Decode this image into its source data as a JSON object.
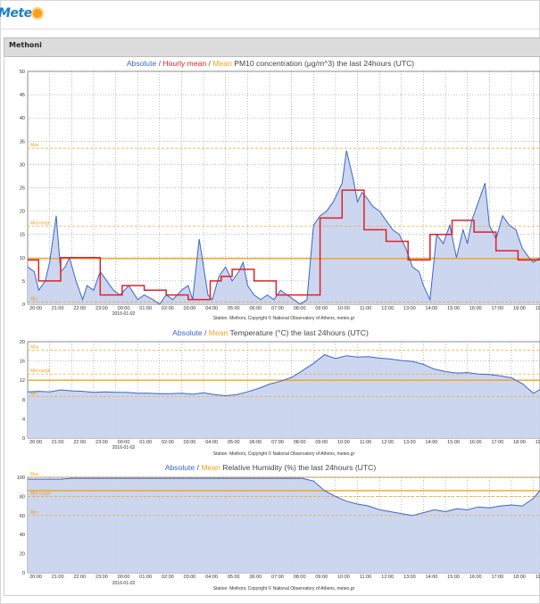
{
  "site": {
    "logo_text": "Mete",
    "logo_icon": "sun-icon"
  },
  "station_header": "Methoni",
  "chart_data": [
    {
      "type": "line",
      "title_parts": [
        {
          "text": "Absolute",
          "color": "#3a67c9"
        },
        {
          "text": " / ",
          "color": "#555555"
        },
        {
          "text": "Hourly mean",
          "color": "#e0202a"
        },
        {
          "text": " / ",
          "color": "#555555"
        },
        {
          "text": "Mean",
          "color": "#f2a21e"
        },
        {
          "text": " PM10 concentration (μg/m^3) the last 24hours (UTC)",
          "color": "#444444"
        }
      ],
      "ylim": [
        0,
        50
      ],
      "yticks": [
        0,
        5,
        10,
        15,
        20,
        25,
        30,
        35,
        40,
        45,
        50
      ],
      "x_ticks": [
        "20:00",
        "21:00",
        "22:00",
        "23:00",
        "00:00",
        "01:00",
        "02:00",
        "03:00",
        "04:00",
        "05:00",
        "06:00",
        "07:00",
        "08:00",
        "09:00",
        "10:00",
        "11:00",
        "12:00",
        "13:00",
        "14:00",
        "15:00",
        "16:00",
        "17:00",
        "18:00",
        "19:00"
      ],
      "date_label": "2016-01-02",
      "xrange": [
        0,
        23.3
      ],
      "footer": "Station: Methoni, Copyright © National Observatory of Athens, meteo.gr",
      "ref_lines": [
        {
          "label": "Max",
          "value": 33.5,
          "style": "dashed"
        },
        {
          "label": "Mid-range",
          "value": 16.8,
          "style": "dashed"
        },
        {
          "label": "Min",
          "value": 0.5,
          "style": "dashed"
        },
        {
          "label": "",
          "value": 9.8,
          "style": "solid"
        }
      ],
      "colors": {
        "absolute": "#3a67c9",
        "fill": "#c9d4ee",
        "hourly": "#e0202a",
        "mean": "#f2a21e"
      },
      "series": [
        {
          "name": "Absolute",
          "x": [
            0,
            0.3,
            0.5,
            0.8,
            1,
            1.3,
            1.5,
            1.7,
            1.9,
            2.2,
            2.5,
            2.7,
            3,
            3.3,
            3.6,
            3.9,
            4.2,
            4.6,
            5,
            5.3,
            5.7,
            6,
            6.3,
            6.6,
            7,
            7.3,
            7.5,
            7.8,
            8,
            8.2,
            8.4,
            8.7,
            9,
            9.3,
            9.6,
            9.8,
            10,
            10.3,
            10.6,
            10.9,
            11.2,
            11.5,
            11.8,
            12.1,
            12.4,
            12.7,
            13,
            13.3,
            13.6,
            13.9,
            14.1,
            14.3,
            14.5,
            14.8,
            15,
            15.2,
            15.4,
            15.7,
            16,
            16.3,
            16.6,
            16.9,
            17.2,
            17.5,
            17.8,
            18,
            18.3,
            18.6,
            18.9,
            19.2,
            19.5,
            19.8,
            20,
            20.2,
            20.5,
            20.8,
            21,
            21.3,
            21.6,
            21.9,
            22.2,
            22.5,
            22.8,
            23,
            23.3
          ],
          "values": [
            8,
            7,
            3,
            5,
            9,
            19,
            7,
            8,
            10,
            5,
            1,
            4,
            3,
            7,
            5,
            3,
            2,
            4,
            1,
            2,
            1,
            0,
            2,
            1,
            3,
            4,
            1,
            14,
            8,
            2,
            1,
            6,
            8,
            5,
            7,
            9,
            4,
            2,
            1,
            2,
            1,
            3,
            2,
            1,
            0,
            1,
            17,
            19,
            20,
            22,
            24,
            26,
            33,
            27,
            22,
            24,
            23,
            21,
            20,
            18,
            16,
            15,
            12,
            8,
            7,
            4,
            1,
            15,
            13,
            17,
            10,
            16,
            13,
            18,
            22,
            26,
            17,
            14,
            19,
            17,
            16,
            12,
            10,
            9,
            10
          ]
        },
        {
          "name": "Hourly mean",
          "x": [
            0,
            0.5,
            1,
            1.5,
            2.3,
            3.3,
            4.3,
            5.3,
            6.3,
            7.3,
            8.3,
            8.8,
            9.3,
            10.3,
            11.3,
            12.3,
            13.3,
            14.3,
            15.3,
            16.3,
            17.3,
            18.3,
            19.3,
            20.3,
            21.3,
            22.3,
            23.3
          ],
          "values": [
            9.5,
            5,
            5,
            10,
            10,
            2,
            4,
            3,
            2,
            1,
            5,
            6,
            7.5,
            5,
            2,
            2,
            18.5,
            24.5,
            16,
            13.5,
            9.5,
            15,
            18,
            15.5,
            11.5,
            9.5,
            9.5
          ]
        },
        {
          "name": "Mean",
          "values": [
            9.8
          ]
        }
      ]
    },
    {
      "type": "line",
      "title_parts": [
        {
          "text": "Absolute",
          "color": "#3a67c9"
        },
        {
          "text": " / ",
          "color": "#555555"
        },
        {
          "text": "Mean",
          "color": "#f2a21e"
        },
        {
          "text": " Temperature (°C) the last 24hours (UTC)",
          "color": "#444444"
        }
      ],
      "ylim": [
        0,
        20
      ],
      "yticks": [
        0,
        4,
        8,
        12,
        16,
        20
      ],
      "x_ticks": [
        "20:00",
        "21:00",
        "22:00",
        "23:00",
        "00:00",
        "01:00",
        "02:00",
        "03:00",
        "04:00",
        "05:00",
        "06:00",
        "07:00",
        "08:00",
        "09:00",
        "10:00",
        "11:00",
        "12:00",
        "13:00",
        "14:00",
        "15:00",
        "16:00",
        "17:00",
        "18:00",
        "19:00"
      ],
      "date_label": "2016-01-02",
      "xrange": [
        0,
        23.3
      ],
      "footer": "Station: Methoni, Copyright © National Observatory of Athens, meteo.gr",
      "ref_lines": [
        {
          "label": "Max",
          "value": 18.2,
          "style": "dashed"
        },
        {
          "label": "Mid-range",
          "value": 13.3,
          "style": "dashed"
        },
        {
          "label": "Min",
          "value": 8.6,
          "style": "dashed"
        },
        {
          "label": "",
          "value": 12,
          "style": "solid"
        }
      ],
      "colors": {
        "absolute": "#3a67c9",
        "fill": "#c9d4ee",
        "mean": "#f2a21e"
      },
      "series": [
        {
          "name": "Absolute",
          "x": [
            0,
            0.5,
            1,
            1.5,
            2,
            2.5,
            3,
            3.5,
            4,
            4.5,
            5,
            5.5,
            6,
            6.5,
            7,
            7.5,
            8,
            8.5,
            9,
            9.5,
            10,
            10.5,
            11,
            11.5,
            12,
            12.5,
            13,
            13.5,
            14,
            14.5,
            15,
            15.5,
            16,
            16.5,
            17,
            17.5,
            18,
            18.5,
            19,
            19.5,
            20,
            20.5,
            21,
            21.5,
            22,
            22.5,
            23,
            23.3
          ],
          "values": [
            9.6,
            9.7,
            9.6,
            10,
            9.8,
            9.7,
            9.5,
            9.6,
            9.5,
            9.5,
            9.3,
            9.3,
            9.2,
            9.2,
            9.3,
            9.1,
            9.4,
            9.0,
            8.8,
            9.0,
            9.6,
            10.3,
            11.2,
            11.8,
            12.6,
            14,
            15.5,
            17.3,
            16.5,
            17.1,
            16.8,
            16.9,
            16.6,
            16.4,
            16.1,
            15.9,
            15.3,
            14.3,
            13.8,
            13.5,
            13.6,
            13.3,
            13.2,
            12.9,
            12.5,
            11.3,
            9.3,
            10.1
          ]
        },
        {
          "name": "Mean",
          "values": [
            12
          ]
        }
      ]
    },
    {
      "type": "line",
      "title_parts": [
        {
          "text": "Absolute",
          "color": "#3a67c9"
        },
        {
          "text": " / ",
          "color": "#555555"
        },
        {
          "text": "Mean",
          "color": "#f2a21e"
        },
        {
          "text": " Relative Humidity (%) the last 24hours (UTC)",
          "color": "#444444"
        }
      ],
      "ylim": [
        0,
        100
      ],
      "yticks": [
        0,
        20,
        40,
        60,
        80,
        100
      ],
      "x_ticks": [
        "20:00",
        "21:00",
        "22:00",
        "23:00",
        "00:00",
        "01:00",
        "02:00",
        "03:00",
        "04:00",
        "05:00",
        "06:00",
        "07:00",
        "08:00",
        "09:00",
        "10:00",
        "11:00",
        "12:00",
        "13:00",
        "14:00",
        "15:00",
        "16:00",
        "17:00",
        "18:00",
        "19:00"
      ],
      "date_label": "2016-01-02",
      "xrange": [
        0,
        23.3
      ],
      "footer": "Station: Methoni, Copyright © National Observatory of Athens, meteo.gr",
      "ref_lines": [
        {
          "label": "Max",
          "value": 100,
          "style": "dashed"
        },
        {
          "label": "Mid-range",
          "value": 80,
          "style": "dashed"
        },
        {
          "label": "Min",
          "value": 60,
          "style": "dashed"
        },
        {
          "label": "",
          "value": 86,
          "style": "solid"
        }
      ],
      "colors": {
        "absolute": "#3a67c9",
        "fill": "#c9d4ee",
        "mean": "#f2a21e"
      },
      "series": [
        {
          "name": "Absolute",
          "x": [
            0,
            0.5,
            1,
            1.5,
            2,
            2.5,
            3,
            3.5,
            4,
            4.5,
            5,
            5.5,
            6,
            6.5,
            7,
            7.5,
            8,
            8.5,
            9,
            9.5,
            10,
            10.5,
            11,
            11.5,
            12,
            12.5,
            13,
            13.5,
            14,
            14.5,
            15,
            15.5,
            16,
            16.5,
            17,
            17.5,
            18,
            18.5,
            19,
            19.5,
            20,
            20.5,
            21,
            21.5,
            22,
            22.5,
            23,
            23.3
          ],
          "values": [
            98,
            98,
            98,
            98,
            99,
            99,
            99,
            99,
            99,
            99,
            99,
            99,
            99,
            99,
            99,
            99,
            99,
            99,
            99,
            99,
            99,
            99,
            99,
            99,
            99,
            99,
            96,
            86,
            80,
            75,
            72,
            70,
            66,
            64,
            62,
            60,
            63,
            66,
            64,
            67,
            66,
            69,
            68,
            70,
            71,
            70,
            78,
            86
          ]
        },
        {
          "name": "Mean",
          "values": [
            86
          ]
        }
      ]
    }
  ]
}
